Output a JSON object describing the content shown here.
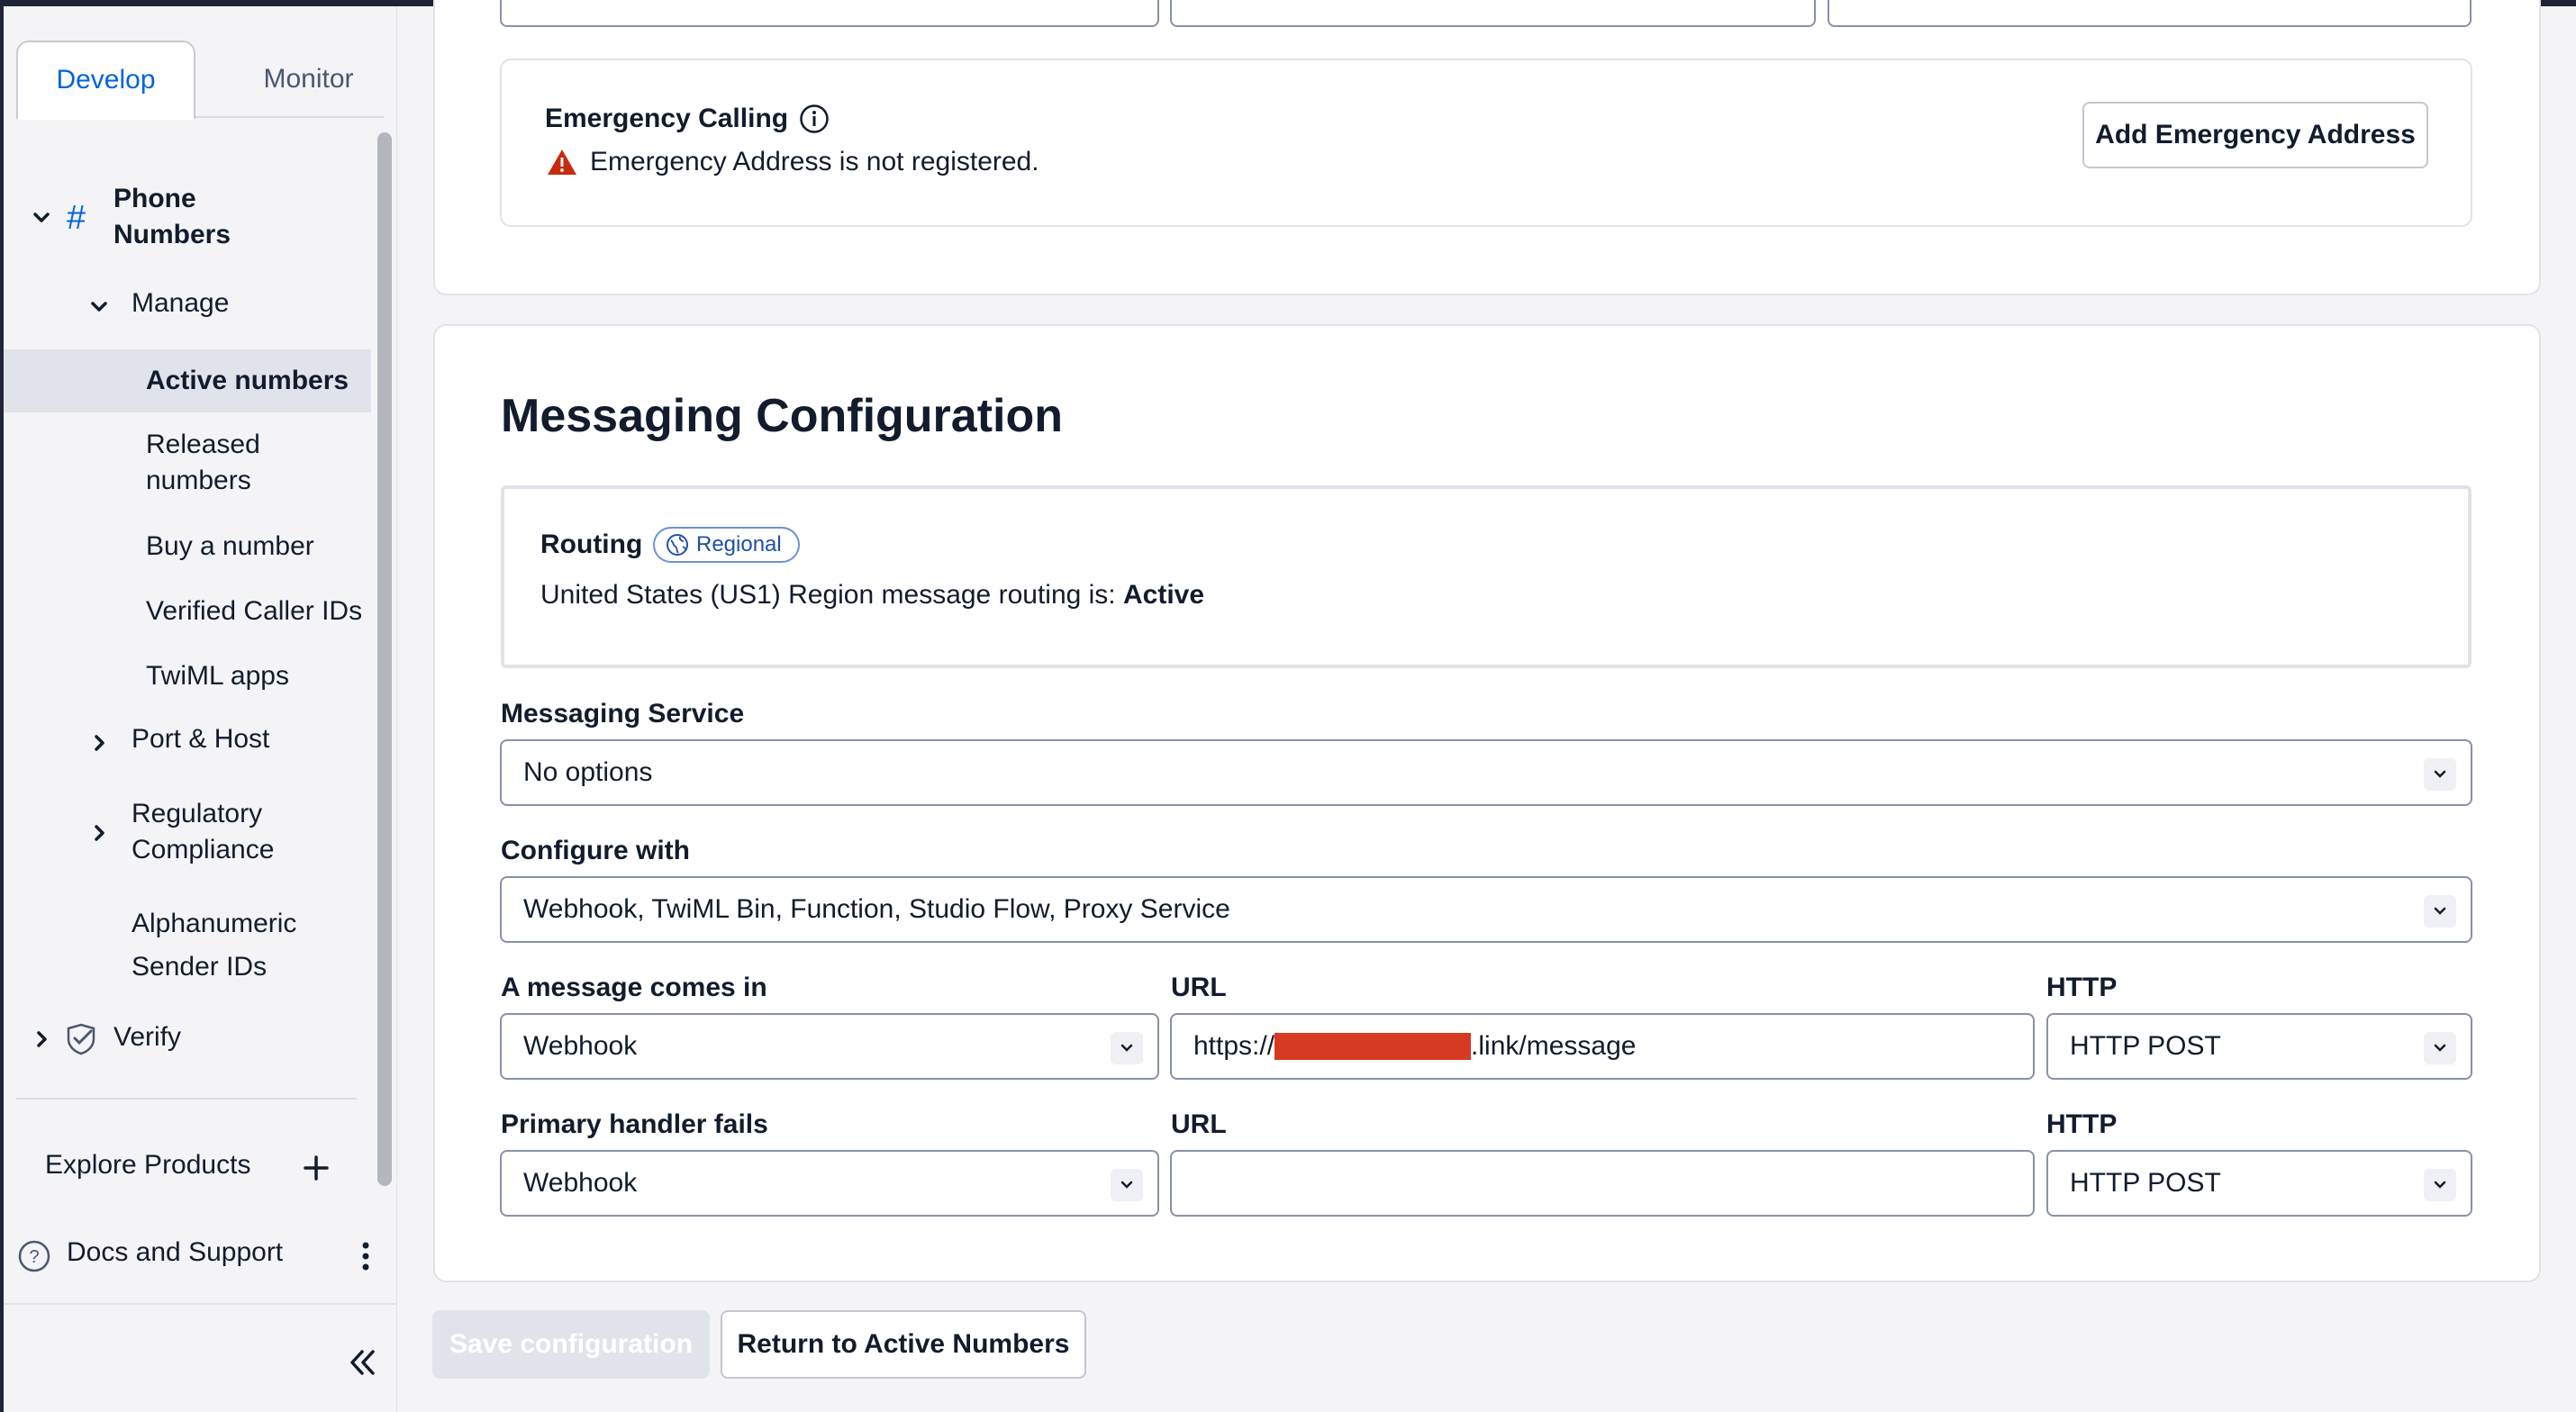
{
  "sidebar": {
    "tabs": [
      {
        "label": "Develop",
        "active": true
      },
      {
        "label": "Monitor",
        "active": false
      }
    ],
    "section_title": "Phone Numbers",
    "manage_label": "Manage",
    "items": [
      {
        "label": "Active numbers",
        "active": true
      },
      {
        "label": "Released numbers"
      },
      {
        "label": "Buy a number"
      },
      {
        "label": "Verified Caller IDs"
      },
      {
        "label": "TwiML apps"
      }
    ],
    "port_host": "Port & Host",
    "regulatory": "Regulatory Compliance",
    "alphanumeric": "Alphanumeric Sender IDs",
    "verify": "Verify",
    "explore_products": "Explore Products",
    "docs_support": "Docs and Support"
  },
  "emergency": {
    "title": "Emergency Calling",
    "warning": "Emergency Address is not registered.",
    "add_button": "Add Emergency Address"
  },
  "messaging": {
    "title": "Messaging Configuration",
    "routing_label": "Routing",
    "routing_badge": "Regional",
    "routing_status_prefix": "United States (US1) Region message routing is: ",
    "routing_status_value": "Active",
    "service_label": "Messaging Service",
    "service_value": "No options",
    "configure_label": "Configure with",
    "configure_value": "Webhook, TwiML Bin, Function, Studio Flow, Proxy Service",
    "incoming_label": "A message comes in",
    "incoming_value": "Webhook",
    "url_label": "URL",
    "incoming_url_prefix": "https://",
    "incoming_url_suffix": ".link/message",
    "http_label": "HTTP",
    "incoming_http": "HTTP POST",
    "fail_label": "Primary handler fails",
    "fail_value": "Webhook",
    "fail_url_label": "URL",
    "fail_url_value": "",
    "fail_http_label": "HTTP",
    "fail_http": "HTTP POST"
  },
  "actions": {
    "save": "Save configuration",
    "return": "Return to Active Numbers"
  },
  "colors": {
    "accent": "#0263e0",
    "warning": "#c72a0f",
    "redaction": "#d63a21"
  }
}
